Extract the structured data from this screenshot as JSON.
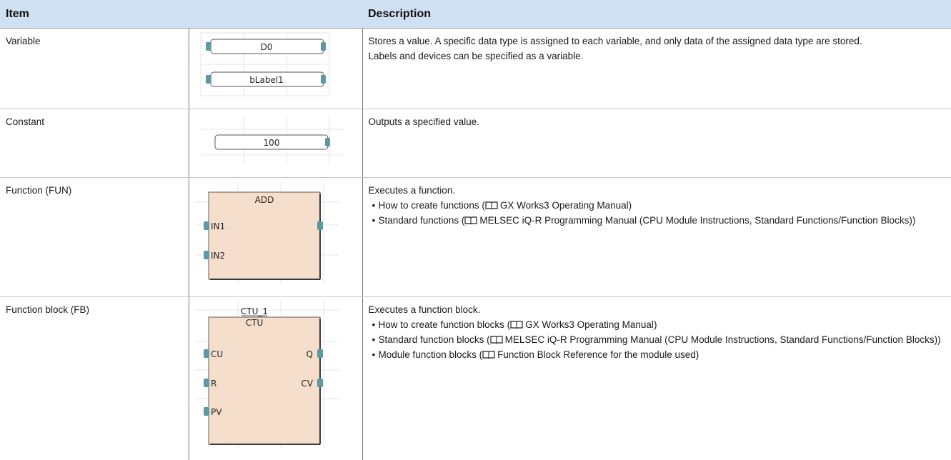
{
  "header": {
    "item": "Item",
    "description": "Description"
  },
  "rows": [
    {
      "item": "Variable",
      "figure": {
        "labels": [
          "D0",
          "bLabel1"
        ]
      },
      "description": [
        "Stores a value. A specific data type is assigned to each variable, and only data of the assigned data type are stored.",
        "Labels and devices can be specified as a variable."
      ]
    },
    {
      "item": "Constant",
      "figure": {
        "label": "100"
      },
      "description": [
        "Outputs a specified value."
      ]
    },
    {
      "item": "Function (FUN)",
      "figure": {
        "name": "ADD",
        "inputs": [
          "IN1",
          "IN2"
        ]
      },
      "description": [
        "Executes a function."
      ],
      "bullets": [
        {
          "text": "How to create functions (",
          "ref": "GX Works3 Operating Manual",
          "end": ")"
        },
        {
          "text": "Standard functions (",
          "ref": "MELSEC iQ-R Programming Manual (CPU Module Instructions, Standard Functions/Function Blocks)",
          "end": ")"
        }
      ]
    },
    {
      "item": "Function block (FB)",
      "figure": {
        "instance": "CTU_1",
        "name": "CTU",
        "inputs": [
          "CU",
          "R",
          "PV"
        ],
        "outputs": [
          "Q",
          "CV"
        ]
      },
      "description": [
        "Executes a function block."
      ],
      "bullets": [
        {
          "text": "How to create function blocks (",
          "ref": "GX Works3 Operating Manual",
          "end": ")"
        },
        {
          "text": "Standard function blocks (",
          "ref": "MELSEC iQ-R Programming Manual (CPU Module Instructions, Standard Functions/Function Blocks)",
          "end": ")"
        },
        {
          "text": "Module function blocks (",
          "ref": "Function Block Reference for the module used",
          "end": ")"
        }
      ]
    }
  ],
  "colors": {
    "header_bg": "#cfe0f3",
    "block_fill": "#f5dfcc",
    "connector": "#5b9aa0",
    "grid": "#e4e4e4"
  },
  "icons": {
    "reference": "book-icon"
  }
}
